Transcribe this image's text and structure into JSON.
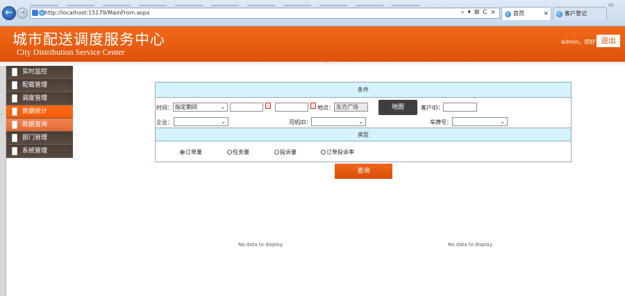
{
  "browser": {
    "url": "http://localhost:15179/MainFrom.aspx",
    "addr_tools": "⌕ ▾ ⊠ C ×",
    "tabs": [
      {
        "label": "首页",
        "active": true
      },
      {
        "label": "客户登记",
        "active": false
      }
    ],
    "tab_close": "×"
  },
  "header": {
    "title": "城市配送调度服务中心",
    "subtitle": "City Distribution Service Center",
    "greeting": "admin，您好！",
    "logout_label": "退出",
    "brand_color": "#e55a0c"
  },
  "sidebar": {
    "items": [
      {
        "label": "实时监控",
        "state": "normal"
      },
      {
        "label": "配载管理",
        "state": "normal"
      },
      {
        "label": "调度管理",
        "state": "normal"
      },
      {
        "label": "数据统计",
        "state": "active"
      },
      {
        "label": "数据查询",
        "state": "hover"
      },
      {
        "label": "部门管理",
        "state": "normal"
      },
      {
        "label": "系统管理",
        "state": "normal"
      }
    ]
  },
  "search": {
    "head_top": "条件",
    "head_mid": "类型",
    "time_label": "时间：",
    "time_select": "指定期间",
    "place_label": "地点：",
    "place_value": "东方广场",
    "map_button": "地图",
    "customer_id_label": "客户ID：",
    "company_label": "企业：",
    "driver_id_label": "司机ID：",
    "plate_label": "车牌号：",
    "radios": [
      {
        "label": "订单量",
        "checked": true
      },
      {
        "label": "任务量",
        "checked": false
      },
      {
        "label": "投诉量",
        "checked": false
      },
      {
        "label": "订单投诉率",
        "checked": false
      }
    ],
    "query_button": "查询"
  },
  "results": {
    "left_empty": "No data to display.",
    "right_empty": "No data to display."
  }
}
